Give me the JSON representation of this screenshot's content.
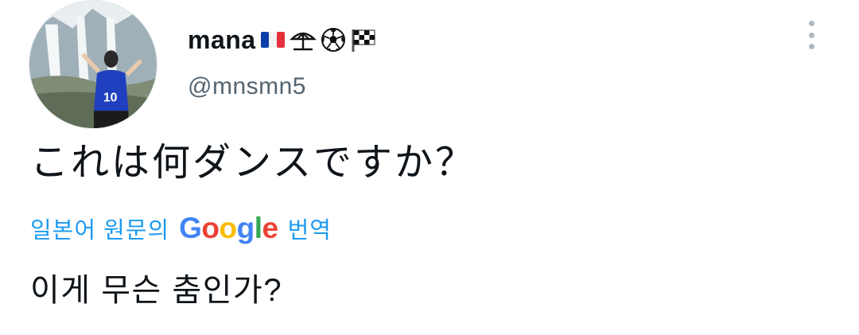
{
  "user": {
    "display_name": "mana",
    "name_emojis": [
      "flag-france-icon",
      "beach-umbrella-icon",
      "soccer-ball-icon",
      "checkered-flag-icon"
    ],
    "handle": "@mnsmn5"
  },
  "tweet": {
    "text": "これは何ダンスですか？"
  },
  "translation": {
    "label": "일본어 원문의",
    "provider": "Google",
    "suffix": "번역",
    "text": "이게 무슨 춤인가?"
  },
  "colors": {
    "link_blue": "#1d9bf0",
    "handle_gray": "#536471",
    "text_dark": "#0f1419",
    "google_blue": "#4285f4",
    "google_red": "#ea4335",
    "google_yellow": "#fbbc05",
    "google_green": "#34a853"
  },
  "icons": {
    "more": "more-vertical-icon"
  }
}
